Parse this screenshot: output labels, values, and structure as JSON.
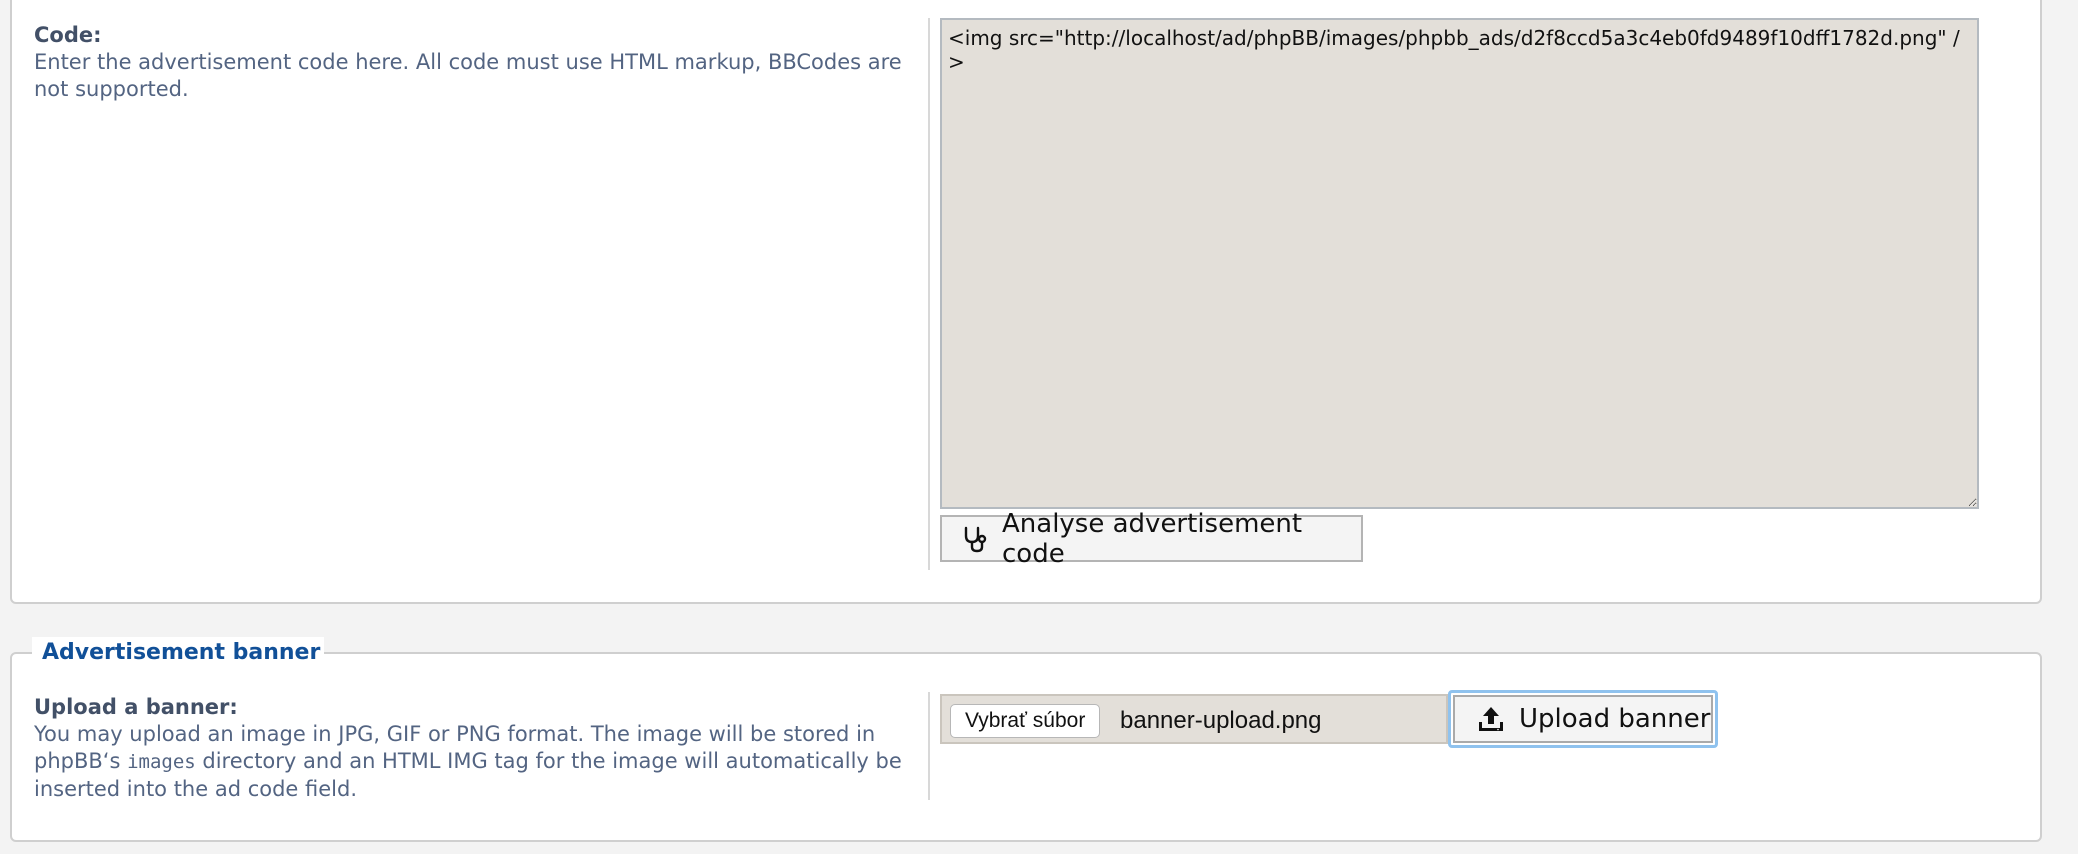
{
  "code_section": {
    "label": "Code:",
    "description": "Enter the advertisement code here. All code must use HTML markup, BBCodes are not supported.",
    "code_value": "<img src=\"http://localhost/ad/phpBB/images/phpbb_ads/d2f8ccd5a3c4eb0fd9489f10dff1782d.png\" />",
    "analyse_button_label": "Analyse advertisement code",
    "analyse_icon": "stethoscope-icon"
  },
  "banner_section": {
    "legend": "Advertisement banner",
    "label": "Upload a banner:",
    "description_before": "You may upload an image in JPG, GIF or PNG format. The image will be stored in phpBB‘s ",
    "description_code": "images",
    "description_after": " directory and an HTML IMG tag for the image will automatically be inserted into the ad code field.",
    "choose_file_label": "Vybrať súbor",
    "file_name": "banner-upload.png",
    "upload_button_label": "Upload banner",
    "upload_icon": "upload-icon"
  },
  "colors": {
    "legend": "#115098",
    "text": "#536482",
    "textarea_bg": "#e3dfd9",
    "focus_ring": "#8fc2ee"
  }
}
